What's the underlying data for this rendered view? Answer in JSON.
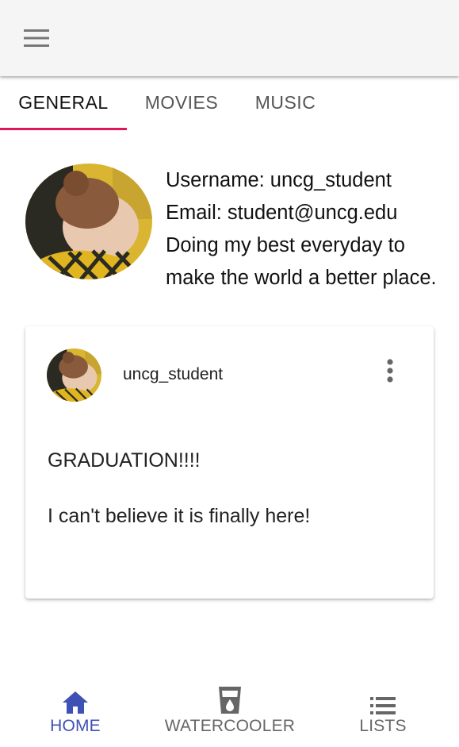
{
  "app_bar": {
    "menu_icon": "hamburger-menu-icon"
  },
  "tabs": [
    {
      "label": "GENERAL",
      "active": true
    },
    {
      "label": "MOVIES",
      "active": false
    },
    {
      "label": "MUSIC",
      "active": false
    }
  ],
  "colors": {
    "tab_indicator": "#e0155e",
    "nav_active": "#3f51b5",
    "nav_inactive": "#666666"
  },
  "profile": {
    "username_line": "Username: uncg_student",
    "email_line": "Email: student@uncg.edu",
    "bio": "Doing my best everyday to make the world a better place."
  },
  "post": {
    "author": "uncg_student",
    "title": "GRADUATION!!!!",
    "body": "I can't believe it is finally here!",
    "more_icon": "more-vert-icon"
  },
  "bottom_nav": [
    {
      "label": "HOME",
      "icon": "home-icon",
      "active": true
    },
    {
      "label": "WATERCOOLER",
      "icon": "cup-icon",
      "active": false
    },
    {
      "label": "LISTS",
      "icon": "list-icon",
      "active": false
    }
  ]
}
